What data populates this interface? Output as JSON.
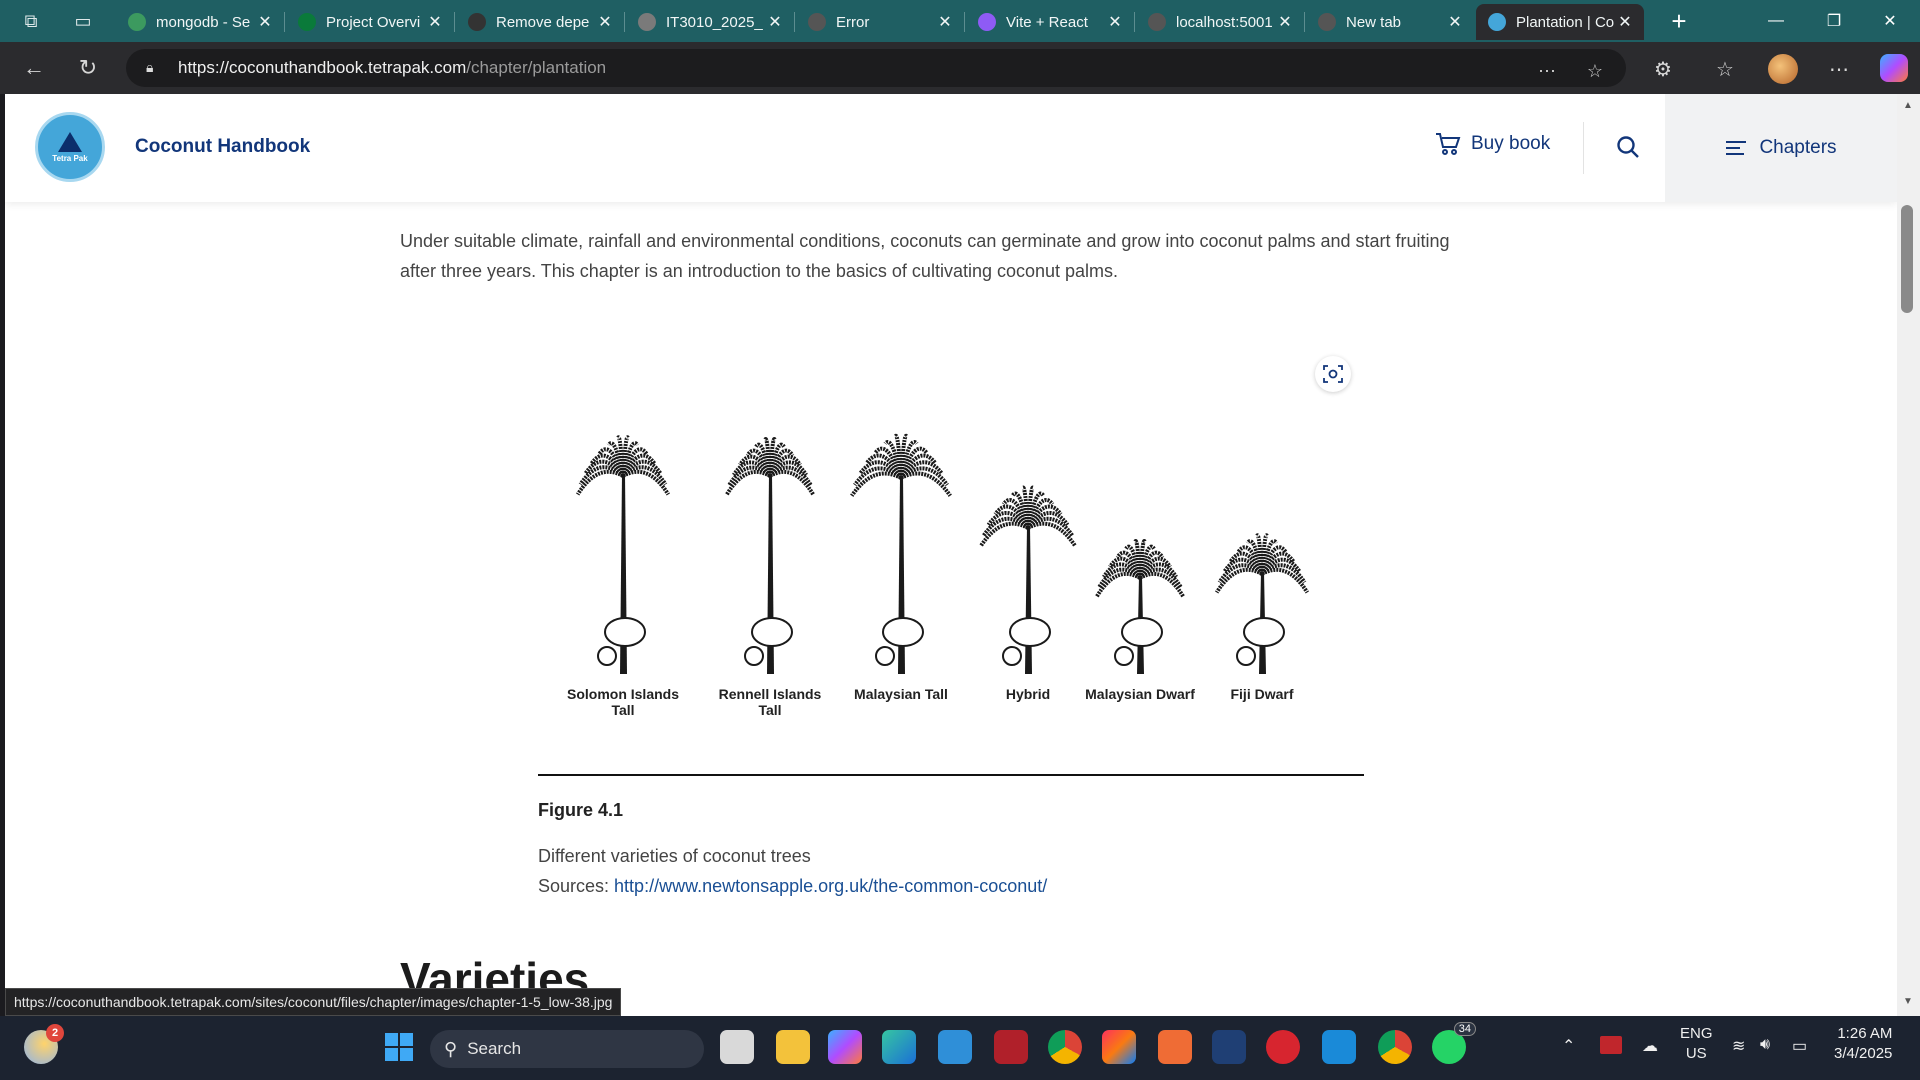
{
  "browser": {
    "tabs": [
      {
        "label": "mongodb - Se",
        "icon": "mongodb-search-icon",
        "color": "#3c9a5f"
      },
      {
        "label": "Project Overvi",
        "icon": "mongodb-leaf-icon",
        "color": "#0a7a3a"
      },
      {
        "label": "Remove depe",
        "icon": "chatgpt-icon",
        "color": "#333333"
      },
      {
        "label": "IT3010_2025_",
        "icon": "document-icon",
        "color": "#7a7a7a"
      },
      {
        "label": "Error",
        "icon": "globe-icon",
        "color": "#555555"
      },
      {
        "label": "Vite + React",
        "icon": "vite-icon",
        "color": "#8e5bf5"
      },
      {
        "label": "localhost:5001",
        "icon": "globe-icon",
        "color": "#555555"
      },
      {
        "label": "New tab",
        "icon": "new-tab-icon",
        "color": "#555555"
      },
      {
        "label": "Plantation | Co",
        "icon": "tetrapak-icon",
        "color": "#44a6d9"
      }
    ],
    "url_host": "https://coconuthandbook.tetrapak.com",
    "url_path": "/chapter/plantation"
  },
  "site": {
    "title": "Coconut Handbook",
    "logo_text": "Tetra Pak",
    "buy_label": "Buy book",
    "chapters_label": "Chapters"
  },
  "content": {
    "intro": "Under suitable climate, rainfall and environmental conditions, coconuts can germinate and grow into coconut palms and start fruiting after three years. This chapter is an introduction to the basics of cultivating coconut palms.",
    "figure": {
      "varieties": [
        "Solomon Islands Tall",
        "Rennell Islands Tall",
        "Malaysian Tall",
        "Hybrid",
        "Malaysian Dwarf",
        "Fiji Dwarf"
      ],
      "number": "Figure 4.1",
      "caption": "Different varieties of coconut trees",
      "source_prefix": "Sources: ",
      "source_link": "http://www.newtonsapple.org.uk/the-common-coconut/"
    },
    "next_heading": "Varieties"
  },
  "status_url": "https://coconuthandbook.tetrapak.com/sites/coconut/files/chapter/images/chapter-1-5_low-38.jpg",
  "taskbar": {
    "weather_badge": "2",
    "search_label": "Search",
    "whatsapp_badge": "34",
    "lang_top": "ENG",
    "lang_bottom": "US",
    "time": "1:26 AM",
    "date": "3/4/2025"
  }
}
